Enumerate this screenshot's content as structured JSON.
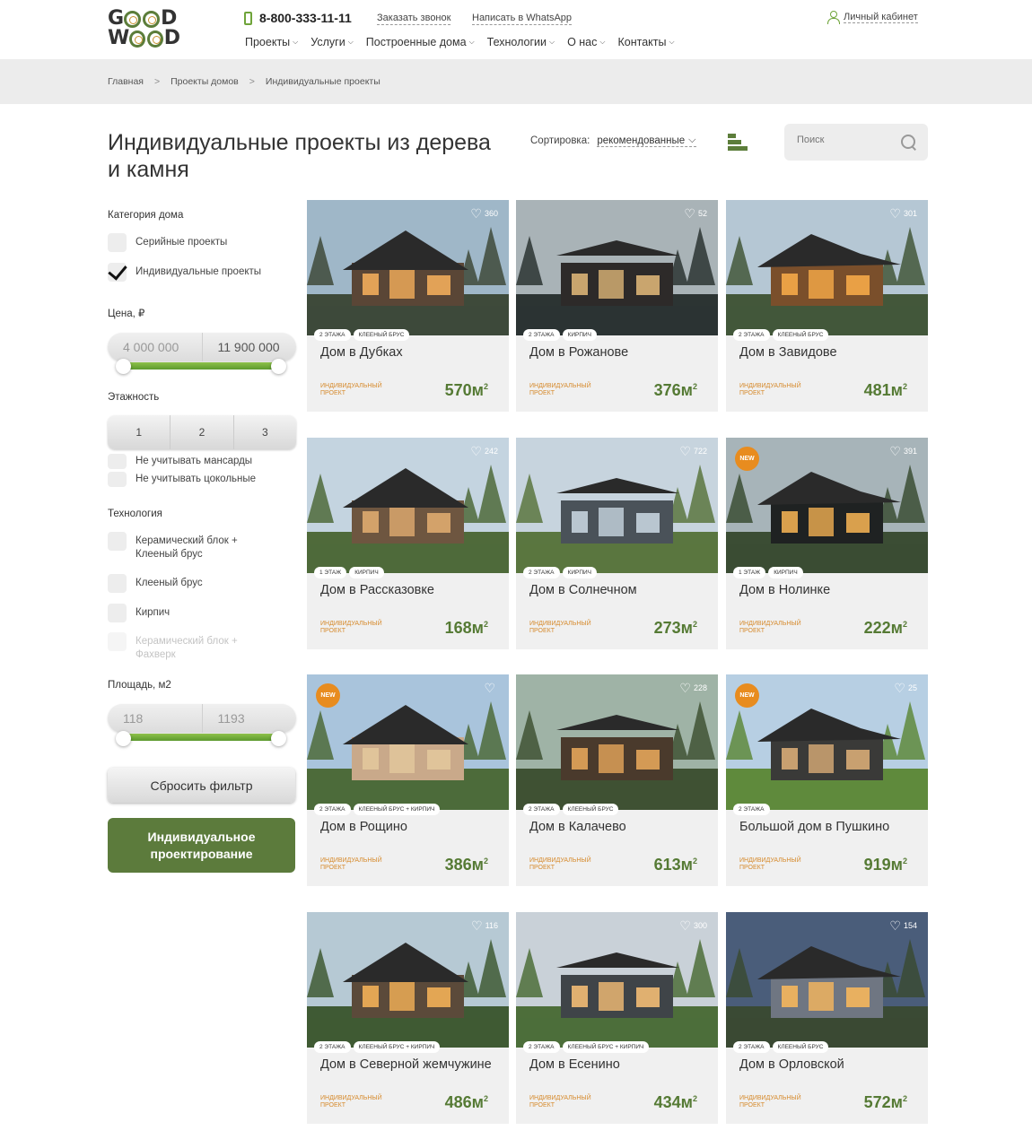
{
  "header": {
    "logo_top": "GOOD",
    "logo_bottom": "WOOD",
    "phone": "8-800-333-11-11",
    "callback": "Заказать звонок",
    "whatsapp": "Написать в WhatsApp",
    "cabinet": "Личный кабинет",
    "nav": [
      "Проекты",
      "Услуги",
      "Построенные дома",
      "Технологии",
      "О нас",
      "Контакты"
    ]
  },
  "breadcrumbs": [
    "Главная",
    "Проекты домов",
    "Индивидуальные проекты"
  ],
  "title": "Индивидуальные проекты из дерева и камня",
  "sort": {
    "label": "Сортировка:",
    "value": "рекомендованные"
  },
  "search": {
    "placeholder": "Поиск"
  },
  "filters": {
    "category": {
      "title": "Категория дома",
      "options": [
        {
          "label": "Серийные проекты",
          "checked": false
        },
        {
          "label": "Индивидуальные проекты",
          "checked": true
        }
      ]
    },
    "price": {
      "title": "Цена, ₽",
      "min": "4 000 000",
      "max": "11 900 000"
    },
    "floors": {
      "title": "Этажность",
      "options": [
        "1",
        "2",
        "3"
      ],
      "no_attic": "Не учитывать мансарды",
      "no_basement": "Не учитывать цокольные"
    },
    "technology": {
      "title": "Технология",
      "options": [
        {
          "label": "Керамический блок + Клееный брус",
          "disabled": false
        },
        {
          "label": "Клееный брус",
          "disabled": false
        },
        {
          "label": "Кирпич",
          "disabled": false
        },
        {
          "label": "Керамический блок + Фахверк",
          "disabled": true
        }
      ]
    },
    "area": {
      "title": "Площадь, м2",
      "min": "118",
      "max": "1193"
    },
    "reset": "Сбросить фильтр",
    "design_button": "Индивидуальное проектирование"
  },
  "project_type": "ИНДИВИДУАЛЬНЫЙ ПРОЕКТ",
  "area_unit": "м",
  "area_unit_power": "2",
  "new_label": "NEW",
  "cards": [
    {
      "name": "Дом в Дубках",
      "area": "570",
      "tags": [
        "2 ЭТАЖА",
        "КЛЕЕНЫЙ БРУС"
      ],
      "likes": "360",
      "is_new": false
    },
    {
      "name": "Дом в Рожанове",
      "area": "376",
      "tags": [
        "2 ЭТАЖА",
        "КИРПИЧ"
      ],
      "likes": "52",
      "is_new": false
    },
    {
      "name": "Дом в Завидове",
      "area": "481",
      "tags": [
        "2 ЭТАЖА",
        "КЛЕЕНЫЙ БРУС"
      ],
      "likes": "301",
      "is_new": false
    },
    {
      "name": "Дом в Рассказовке",
      "area": "168",
      "tags": [
        "1 ЭТАЖ",
        "КИРПИЧ"
      ],
      "likes": "242",
      "is_new": false
    },
    {
      "name": "Дом в Солнечном",
      "area": "273",
      "tags": [
        "2 ЭТАЖА",
        "КИРПИЧ"
      ],
      "likes": "722",
      "is_new": false
    },
    {
      "name": "Дом в Нолинке",
      "area": "222",
      "tags": [
        "1 ЭТАЖ",
        "КИРПИЧ"
      ],
      "likes": "391",
      "is_new": true
    },
    {
      "name": "Дом в Рощино",
      "area": "386",
      "tags": [
        "2 ЭТАЖА",
        "КЛЕЕНЫЙ БРУС + КИРПИЧ"
      ],
      "likes": "",
      "is_new": true
    },
    {
      "name": "Дом в Калачево",
      "area": "613",
      "tags": [
        "2 ЭТАЖА",
        "КЛЕЕНЫЙ БРУС"
      ],
      "likes": "228",
      "is_new": false
    },
    {
      "name": "Большой дом в Пушкино",
      "area": "919",
      "tags": [
        "2 ЭТАЖА"
      ],
      "likes": "25",
      "is_new": true
    },
    {
      "name": "Дом в Северной жемчужине",
      "area": "486",
      "tags": [
        "2 ЭТАЖА",
        "КЛЕЕНЫЙ БРУС + КИРПИЧ"
      ],
      "likes": "116",
      "is_new": false
    },
    {
      "name": "Дом в Есенино",
      "area": "434",
      "tags": [
        "2 ЭТАЖА",
        "КЛЕЕНЫЙ БРУС + КИРПИЧ"
      ],
      "likes": "300",
      "is_new": false
    },
    {
      "name": "Дом в Орловской",
      "area": "572",
      "tags": [
        "2 ЭТАЖА",
        "КЛЕЕНЫЙ БРУС"
      ],
      "likes": "154",
      "is_new": false
    }
  ],
  "colors": {
    "accent_green": "#5c7b3c",
    "price_green": "#557a34",
    "orange": "#d68a2c",
    "new_badge": "#e88c1f"
  }
}
